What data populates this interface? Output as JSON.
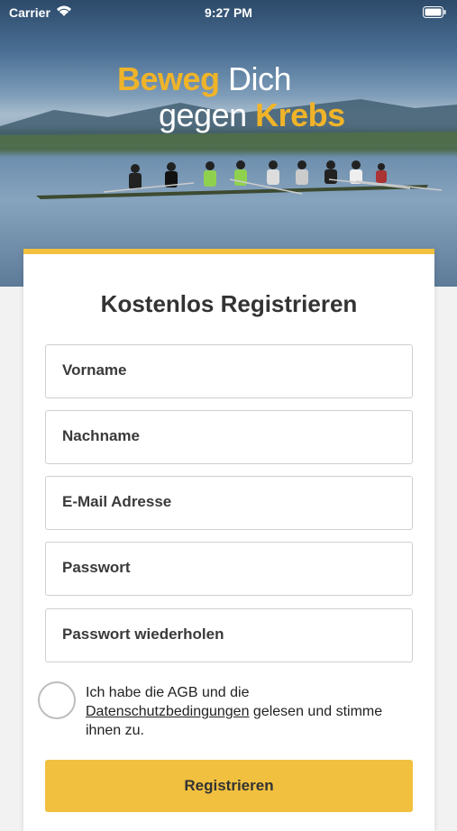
{
  "status_bar": {
    "carrier": "Carrier",
    "time": "9:27 PM"
  },
  "hero": {
    "slogan_line1_highlight": "Beweg",
    "slogan_line1_rest": " Dich",
    "slogan_line2_rest": "gegen ",
    "slogan_line2_highlight": "Krebs"
  },
  "form": {
    "title": "Kostenlos Registrieren",
    "fields": [
      {
        "placeholder": "Vorname"
      },
      {
        "placeholder": "Nachname"
      },
      {
        "placeholder": "E-Mail Adresse"
      },
      {
        "placeholder": "Passwort"
      },
      {
        "placeholder": "Passwort wiederholen"
      }
    ],
    "consent_prefix": "Ich habe die AGB und die ",
    "consent_link": "Datenschutzbedingungen",
    "consent_suffix": " gelesen und stimme ihnen zu.",
    "submit_label": "Registrieren"
  },
  "colors": {
    "accent": "#f2c03f",
    "slogan_highlight": "#f0b429",
    "text_dark": "#333333"
  }
}
